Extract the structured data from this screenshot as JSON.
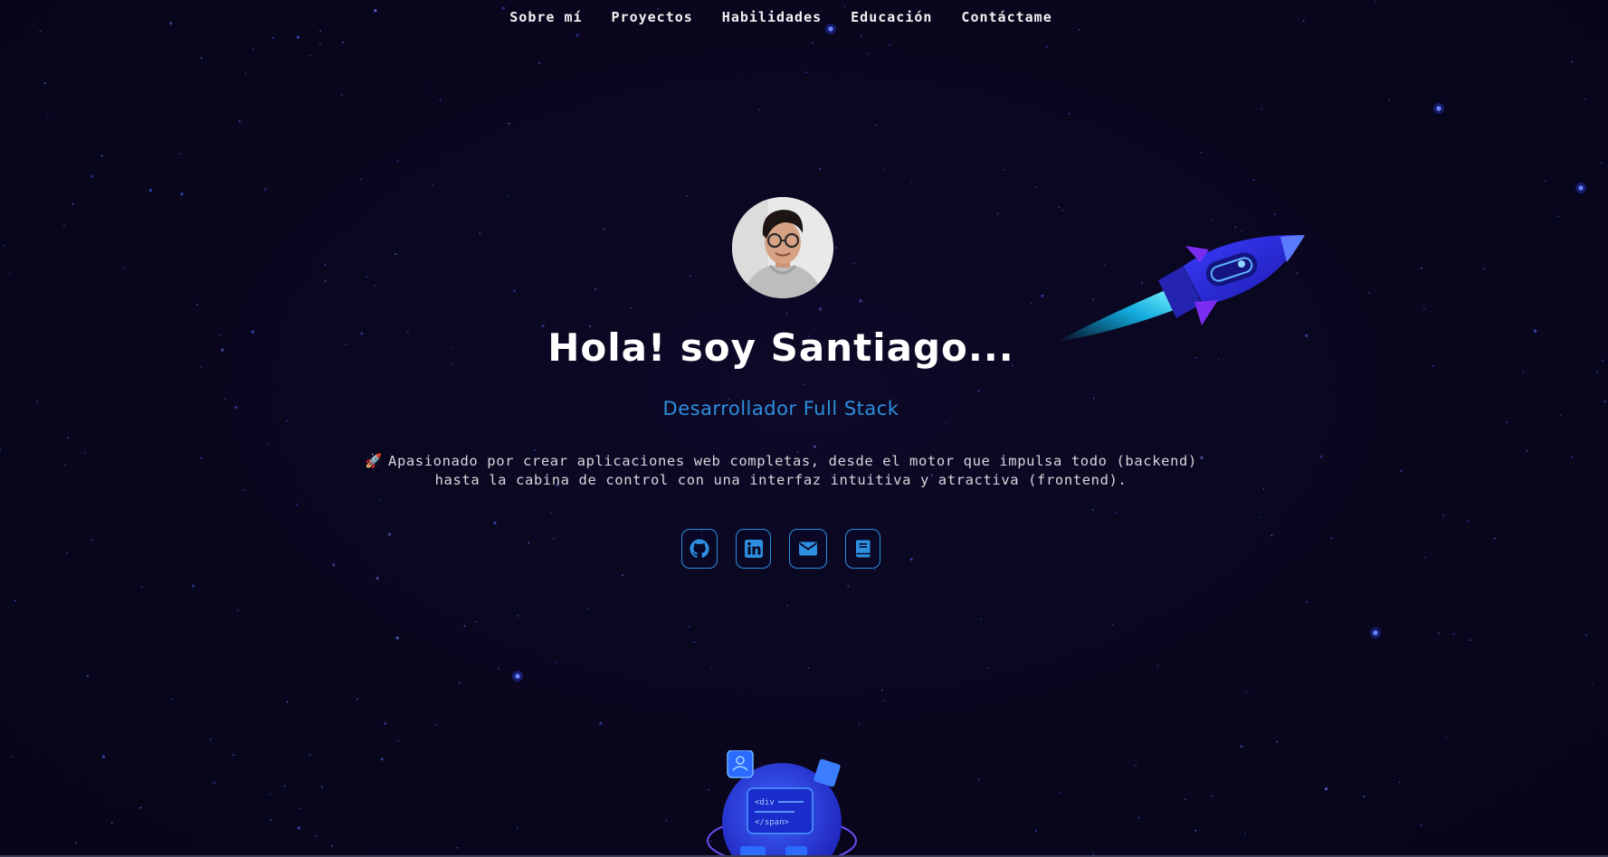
{
  "nav": {
    "items": [
      {
        "label": "Sobre mí"
      },
      {
        "label": "Proyectos"
      },
      {
        "label": "Habilidades"
      },
      {
        "label": "Educación"
      },
      {
        "label": "Contáctame"
      }
    ]
  },
  "hero": {
    "title": "Hola! soy Santiago...",
    "subtitle": "Desarrollador Full Stack",
    "description_icon": "🚀",
    "description": "Apasionado por crear aplicaciones web completas, desde el motor que impulsa todo (backend) hasta la cabina de control con una interfaz intuitiva y atractiva (frontend).",
    "avatar_icon": "profile-photo"
  },
  "socials": [
    {
      "icon": "github-icon"
    },
    {
      "icon": "linkedin-icon"
    },
    {
      "icon": "email-icon"
    },
    {
      "icon": "book-icon"
    }
  ],
  "illustrations": {
    "rocket": "rocket-illustration",
    "globe_code": {
      "line1": "<div",
      "line2": "</span>"
    }
  },
  "colors": {
    "background": "#0a0620",
    "accent": "#2d8fe0",
    "text": "#d6d6dc",
    "title": "#ffffff"
  }
}
